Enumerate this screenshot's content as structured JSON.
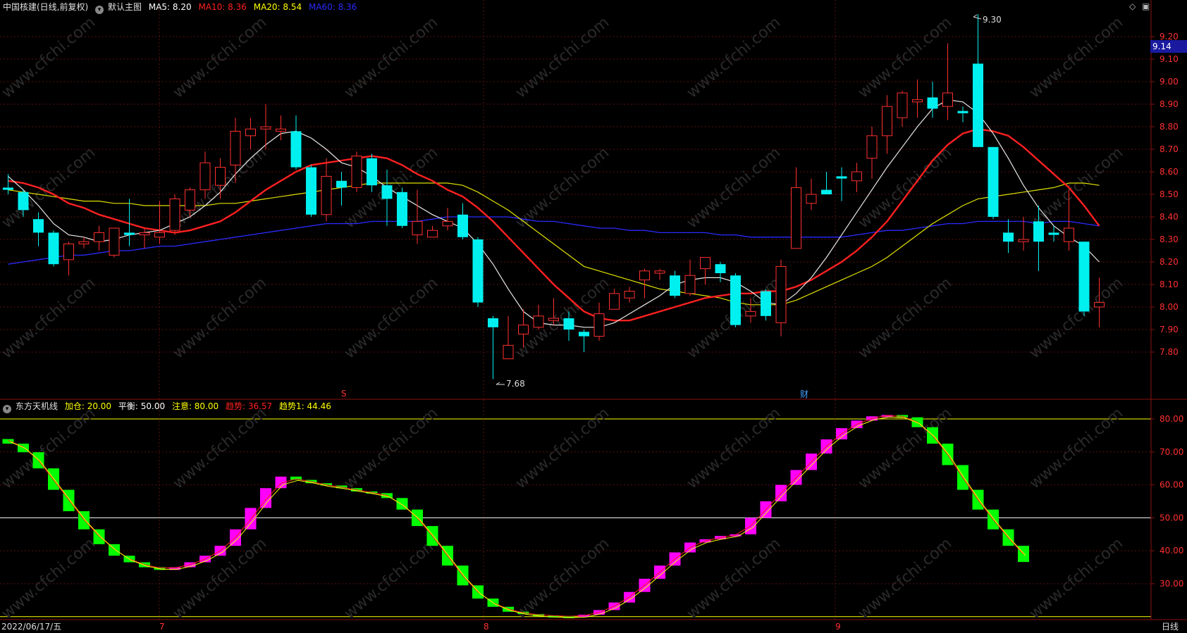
{
  "main_header": {
    "stock": "中国核建(日线,前复权)",
    "indicator": "默认主图",
    "ma": [
      {
        "label": "MA5: 8.20",
        "color": "#ffffff"
      },
      {
        "label": "MA10: 8.36",
        "color": "#ff2020"
      },
      {
        "label": "MA20: 8.54",
        "color": "#ffff00"
      },
      {
        "label": "MA60: 8.36",
        "color": "#2a2aff"
      }
    ]
  },
  "sub_header": {
    "indicator": "东方天机线",
    "items": [
      {
        "label": "加仓: 20.00",
        "color": "#ffff00"
      },
      {
        "label": "平衡: 50.00",
        "color": "#ffffff"
      },
      {
        "label": "注意: 80.00",
        "color": "#ffff00"
      },
      {
        "label": "趋势: 36.57",
        "color": "#ff2020"
      },
      {
        "label": "趋势1: 44.46",
        "color": "#ffff00"
      }
    ]
  },
  "price_axis": [
    "9.20",
    "9.10",
    "9.00",
    "8.90",
    "8.80",
    "8.70",
    "8.60",
    "8.50",
    "8.40",
    "8.30",
    "8.20",
    "8.10",
    "8.00",
    "7.90",
    "7.80"
  ],
  "current_price": "9.14",
  "high_label": "9.30",
  "low_label": "7.68",
  "markers": {
    "s": "S",
    "cai": "财"
  },
  "osc_axis": [
    "80.00",
    "70.00",
    "60.00",
    "50.00",
    "40.00",
    "30.00"
  ],
  "date_left": "2022/06/17/五",
  "months": [
    "7",
    "8",
    "9"
  ],
  "period": "日线",
  "watermark": "www.cfchi.com",
  "colors": {
    "up": "#ff3030",
    "down": "#00f0f0",
    "osc_up": "#ff00ff",
    "osc_down": "#00ff00",
    "grid": "#5a1010"
  },
  "chart_data": {
    "type": "candlestick",
    "candles": [
      [
        8.53,
        8.52,
        8.59,
        8.5
      ],
      [
        8.51,
        8.43,
        8.52,
        8.4
      ],
      [
        8.39,
        8.33,
        8.42,
        8.27
      ],
      [
        8.33,
        8.19,
        8.34,
        8.18
      ],
      [
        8.21,
        8.28,
        8.29,
        8.14
      ],
      [
        8.28,
        8.29,
        8.31,
        8.26
      ],
      [
        8.29,
        8.33,
        8.36,
        8.25
      ],
      [
        8.23,
        8.35,
        8.35,
        8.22
      ],
      [
        8.33,
        8.32,
        8.48,
        8.27
      ],
      [
        8.32,
        8.33,
        8.35,
        8.26
      ],
      [
        8.31,
        8.33,
        8.47,
        8.28
      ],
      [
        8.34,
        8.48,
        8.5,
        8.32
      ],
      [
        8.43,
        8.52,
        8.53,
        8.4
      ],
      [
        8.52,
        8.64,
        8.69,
        8.48
      ],
      [
        8.54,
        8.62,
        8.66,
        8.48
      ],
      [
        8.63,
        8.78,
        8.84,
        8.55
      ],
      [
        8.76,
        8.79,
        8.84,
        8.7
      ],
      [
        8.79,
        8.8,
        8.9,
        8.7
      ],
      [
        8.78,
        8.79,
        8.85,
        8.74
      ],
      [
        8.78,
        8.62,
        8.85,
        8.61
      ],
      [
        8.62,
        8.41,
        8.63,
        8.4
      ],
      [
        8.41,
        8.58,
        8.66,
        8.38
      ],
      [
        8.56,
        8.53,
        8.6,
        8.45
      ],
      [
        8.53,
        8.67,
        8.69,
        8.51
      ],
      [
        8.66,
        8.54,
        8.68,
        8.51
      ],
      [
        8.54,
        8.48,
        8.61,
        8.36
      ],
      [
        8.51,
        8.36,
        8.53,
        8.35
      ],
      [
        8.32,
        8.38,
        8.52,
        8.28
      ],
      [
        8.31,
        8.34,
        8.36,
        8.31
      ],
      [
        8.36,
        8.38,
        8.44,
        8.34
      ],
      [
        8.41,
        8.31,
        8.46,
        8.3
      ],
      [
        8.3,
        8.02,
        8.31,
        8.0
      ],
      [
        7.95,
        7.91,
        7.96,
        7.68
      ],
      [
        7.77,
        7.83,
        7.96,
        7.77
      ],
      [
        7.88,
        7.92,
        7.99,
        7.82
      ],
      [
        7.91,
        7.96,
        8.01,
        7.9
      ],
      [
        7.94,
        7.95,
        8.04,
        7.92
      ],
      [
        7.95,
        7.9,
        7.98,
        7.85
      ],
      [
        7.89,
        7.87,
        7.9,
        7.8
      ],
      [
        7.87,
        7.97,
        8.02,
        7.85
      ],
      [
        7.99,
        8.06,
        8.08,
        7.99
      ],
      [
        8.04,
        8.07,
        8.09,
        8.02
      ],
      [
        8.12,
        8.16,
        8.17,
        8.04
      ],
      [
        8.15,
        8.16,
        8.17,
        8.12
      ],
      [
        8.14,
        8.05,
        8.16,
        8.04
      ],
      [
        8.06,
        8.14,
        8.21,
        8.05
      ],
      [
        8.17,
        8.22,
        8.22,
        8.1
      ],
      [
        8.19,
        8.15,
        8.2,
        8.11
      ],
      [
        8.14,
        7.92,
        8.15,
        7.91
      ],
      [
        7.96,
        7.98,
        8.04,
        7.93
      ],
      [
        8.07,
        7.96,
        8.08,
        7.94
      ],
      [
        7.93,
        8.18,
        8.21,
        7.87
      ],
      [
        8.26,
        8.53,
        8.62,
        8.26
      ],
      [
        8.46,
        8.5,
        8.57,
        8.43
      ],
      [
        8.52,
        8.5,
        8.6,
        8.5
      ],
      [
        8.58,
        8.57,
        8.62,
        8.47
      ],
      [
        8.56,
        8.6,
        8.64,
        8.51
      ],
      [
        8.66,
        8.76,
        8.8,
        8.57
      ],
      [
        8.76,
        8.89,
        8.94,
        8.68
      ],
      [
        8.84,
        8.95,
        8.96,
        8.8
      ],
      [
        8.91,
        8.92,
        9.01,
        8.84
      ],
      [
        8.93,
        8.88,
        9.0,
        8.84
      ],
      [
        8.89,
        8.95,
        9.17,
        8.83
      ],
      [
        8.87,
        8.86,
        8.89,
        8.82
      ],
      [
        9.08,
        8.71,
        9.3,
        8.71
      ],
      [
        8.71,
        8.4,
        8.71,
        8.39
      ],
      [
        8.33,
        8.29,
        8.39,
        8.24
      ],
      [
        8.29,
        8.3,
        8.4,
        8.25
      ],
      [
        8.38,
        8.29,
        8.45,
        8.16
      ],
      [
        8.33,
        8.32,
        8.36,
        8.29
      ],
      [
        8.29,
        8.35,
        8.52,
        8.25
      ],
      [
        8.29,
        7.98,
        8.29,
        7.96
      ],
      [
        8.0,
        8.02,
        8.13,
        7.91
      ]
    ],
    "ma5": [
      8.58,
      8.52,
      8.45,
      8.37,
      8.32,
      8.31,
      8.29,
      8.3,
      8.32,
      8.33,
      8.34,
      8.37,
      8.4,
      8.45,
      8.51,
      8.59,
      8.66,
      8.72,
      8.77,
      8.78,
      8.75,
      8.7,
      8.64,
      8.62,
      8.58,
      8.53,
      8.49,
      8.45,
      8.41,
      8.38,
      8.35,
      8.28,
      8.19,
      8.08,
      7.98,
      7.93,
      7.92,
      7.92,
      7.91,
      7.91,
      7.93,
      7.97,
      8.01,
      8.05,
      8.1,
      8.12,
      8.13,
      8.13,
      8.11,
      8.07,
      8.02,
      8.01,
      8.06,
      8.13,
      8.22,
      8.32,
      8.42,
      8.52,
      8.62,
      8.71,
      8.8,
      8.88,
      8.92,
      8.91,
      8.86,
      8.77,
      8.66,
      8.54,
      8.44,
      8.36,
      8.31,
      8.27,
      8.2
    ],
    "ma10": [
      8.56,
      8.55,
      8.53,
      8.5,
      8.46,
      8.44,
      8.41,
      8.39,
      8.37,
      8.35,
      8.34,
      8.33,
      8.34,
      8.36,
      8.38,
      8.42,
      8.47,
      8.52,
      8.56,
      8.6,
      8.63,
      8.64,
      8.65,
      8.66,
      8.67,
      8.66,
      8.63,
      8.59,
      8.56,
      8.52,
      8.49,
      8.44,
      8.38,
      8.31,
      8.24,
      8.17,
      8.1,
      8.04,
      7.98,
      7.95,
      7.94,
      7.94,
      7.96,
      7.98,
      8.0,
      8.02,
      8.04,
      8.05,
      8.06,
      8.06,
      8.07,
      8.07,
      8.09,
      8.12,
      8.16,
      8.2,
      8.25,
      8.31,
      8.38,
      8.47,
      8.56,
      8.65,
      8.72,
      8.77,
      8.79,
      8.78,
      8.76,
      8.71,
      8.65,
      8.59,
      8.53,
      8.45,
      8.36
    ],
    "ma20": [
      8.52,
      8.51,
      8.5,
      8.49,
      8.48,
      8.47,
      8.47,
      8.46,
      8.46,
      8.45,
      8.45,
      8.45,
      8.45,
      8.45,
      8.46,
      8.46,
      8.47,
      8.48,
      8.49,
      8.5,
      8.51,
      8.52,
      8.53,
      8.54,
      8.55,
      8.55,
      8.55,
      8.55,
      8.55,
      8.55,
      8.54,
      8.51,
      8.47,
      8.43,
      8.38,
      8.33,
      8.28,
      8.23,
      8.18,
      8.16,
      8.14,
      8.12,
      8.1,
      8.08,
      8.07,
      8.06,
      8.05,
      8.04,
      8.02,
      8.01,
      8.01,
      8.01,
      8.03,
      8.06,
      8.09,
      8.12,
      8.15,
      8.18,
      8.22,
      8.27,
      8.32,
      8.37,
      8.41,
      8.45,
      8.48,
      8.49,
      8.5,
      8.51,
      8.52,
      8.53,
      8.55,
      8.55,
      8.54
    ],
    "ma60": [
      8.19,
      8.2,
      8.21,
      8.22,
      8.23,
      8.23,
      8.24,
      8.25,
      8.25,
      8.26,
      8.27,
      8.27,
      8.28,
      8.29,
      8.3,
      8.31,
      8.32,
      8.33,
      8.34,
      8.35,
      8.36,
      8.37,
      8.37,
      8.37,
      8.38,
      8.38,
      8.38,
      8.38,
      8.39,
      8.4,
      8.4,
      8.4,
      8.4,
      8.4,
      8.39,
      8.38,
      8.38,
      8.37,
      8.36,
      8.35,
      8.35,
      8.34,
      8.34,
      8.33,
      8.33,
      8.33,
      8.33,
      8.32,
      8.32,
      8.31,
      8.31,
      8.31,
      8.31,
      8.31,
      8.31,
      8.31,
      8.32,
      8.33,
      8.34,
      8.34,
      8.35,
      8.36,
      8.37,
      8.37,
      8.38,
      8.38,
      8.38,
      8.38,
      8.37,
      8.38,
      8.38,
      8.37,
      8.36
    ],
    "osc_levels": {
      "add": 20,
      "balance": 50,
      "attention": 80
    },
    "osc_bars": [
      [
        73.9,
        72.5
      ],
      [
        72.5,
        69.9
      ],
      [
        69.9,
        65.0
      ],
      [
        65.0,
        58.5
      ],
      [
        58.5,
        52.0
      ],
      [
        52.0,
        46.5
      ],
      [
        46.5,
        42.0
      ],
      [
        42.0,
        38.5
      ],
      [
        38.5,
        36.5
      ],
      [
        36.5,
        35.0
      ],
      [
        35.0,
        34.2
      ],
      [
        34.2,
        35.0
      ],
      [
        35.0,
        36.5
      ],
      [
        36.5,
        38.5
      ],
      [
        38.5,
        41.5
      ],
      [
        41.5,
        46.5
      ],
      [
        46.5,
        53.0
      ],
      [
        53.0,
        59.0
      ],
      [
        59.0,
        62.5
      ],
      [
        62.5,
        61.5
      ],
      [
        61.5,
        60.5
      ],
      [
        60.5,
        59.8
      ],
      [
        59.8,
        59.0
      ],
      [
        59.0,
        58.0
      ],
      [
        58.0,
        57.5
      ],
      [
        57.5,
        56.0
      ],
      [
        56.0,
        52.5
      ],
      [
        52.5,
        47.5
      ],
      [
        47.5,
        41.5
      ],
      [
        41.5,
        35.5
      ],
      [
        35.5,
        29.5
      ],
      [
        29.5,
        25.5
      ],
      [
        25.5,
        23.0
      ],
      [
        23.0,
        21.5
      ],
      [
        21.5,
        20.8
      ],
      [
        20.8,
        20.4
      ],
      [
        20.4,
        20.2
      ],
      [
        20.2,
        20.0
      ],
      [
        20.0,
        20.6
      ],
      [
        20.6,
        22.0
      ],
      [
        22.0,
        24.3
      ],
      [
        24.3,
        27.5
      ],
      [
        27.5,
        31.5
      ],
      [
        31.5,
        35.5
      ],
      [
        35.5,
        39.5
      ],
      [
        39.5,
        42.5
      ],
      [
        42.5,
        43.5
      ],
      [
        43.5,
        44.5
      ],
      [
        44.5,
        45.0
      ],
      [
        45.0,
        50.0
      ],
      [
        50.0,
        55.0
      ],
      [
        55.0,
        60.0
      ],
      [
        60.0,
        64.5
      ],
      [
        64.5,
        69.5
      ],
      [
        69.5,
        73.8
      ],
      [
        73.8,
        77.2
      ],
      [
        77.2,
        79.5
      ],
      [
        79.5,
        80.8
      ],
      [
        80.8,
        81.2
      ],
      [
        81.2,
        80.5
      ],
      [
        80.5,
        77.5
      ],
      [
        77.5,
        72.5
      ],
      [
        72.5,
        66.0
      ],
      [
        66.0,
        58.5
      ],
      [
        58.5,
        52.5
      ],
      [
        52.5,
        46.5
      ],
      [
        46.5,
        41.5
      ],
      [
        41.5,
        36.6
      ]
    ],
    "osc_trend": [
      73.5,
      71.5,
      67.5,
      61.5,
      55.5,
      49.5,
      44.5,
      40.5,
      37.5,
      35.8,
      34.8,
      34.8,
      35.8,
      37.5,
      40.0,
      44.0,
      49.5,
      55.5,
      60.5,
      61.8,
      61.0,
      60.0,
      59.3,
      58.5,
      57.7,
      56.8,
      54.0,
      50.0,
      44.5,
      38.5,
      32.5,
      27.5,
      24.2,
      22.3,
      21.2,
      20.6,
      20.3,
      20.1,
      20.3,
      21.3,
      23.2,
      26.0,
      29.5,
      33.5,
      37.5,
      41.0,
      43.0,
      44.0,
      44.8,
      47.5,
      52.5,
      57.5,
      62.2,
      67.0,
      71.7,
      75.5,
      78.4,
      80.2,
      81.0,
      80.8,
      79.0,
      75.0,
      69.2,
      62.2,
      55.5,
      49.5,
      44.0,
      39.0
    ]
  }
}
